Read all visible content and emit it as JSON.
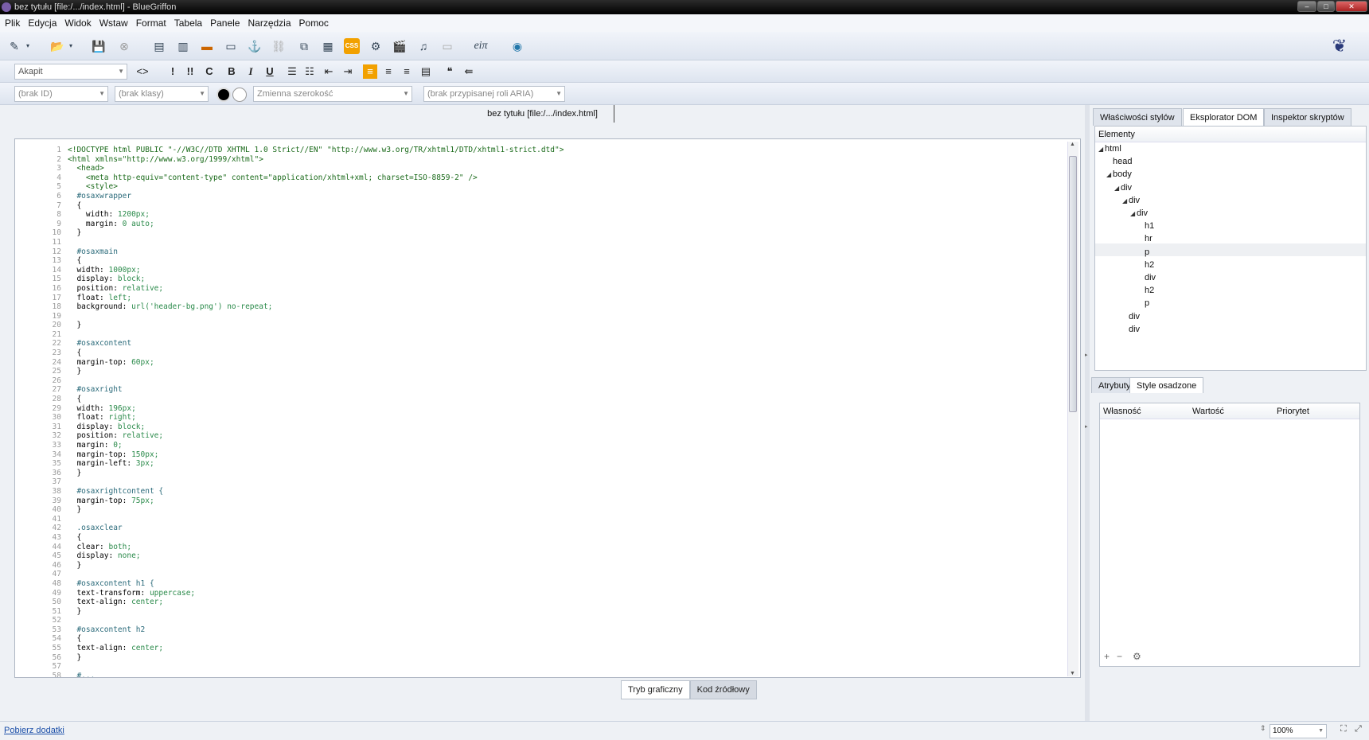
{
  "window": {
    "title": "bez tytułu [file:/.../index.html] - BlueGriffon",
    "buttons": {
      "minimize": "–",
      "maximize": "□",
      "close": "✕"
    }
  },
  "menu": [
    "Plik",
    "Edycja",
    "Widok",
    "Wstaw",
    "Format",
    "Tabela",
    "Panele",
    "Narzędzia",
    "Pomoc"
  ],
  "toolbar1": {
    "icons": [
      "new-document-icon",
      "open-icon",
      "save-icon",
      "close-document-icon",
      "layout-icon",
      "template-icon",
      "image-icon",
      "form-icon",
      "anchor-icon",
      "link-icon",
      "clip-icon",
      "table-icon",
      "css-icon",
      "settings-icon",
      "video-icon",
      "audio-icon",
      "box-icon",
      "math-icon",
      "globe-icon"
    ],
    "css_label": "CSS",
    "math_label": "eiπ"
  },
  "toolbar2": {
    "paragraph_format": "Akapit",
    "buttons": [
      "<>",
      "!",
      "!!",
      "C",
      "B",
      "I",
      "U"
    ]
  },
  "toolbar3": {
    "id_placeholder": "(brak ID)",
    "class_placeholder": "(brak klasy)",
    "width_mode": "Zmienna szerokość",
    "aria_role": "(brak przypisanej roli ARIA)"
  },
  "document_tab": "bez tytułu [file:/.../index.html]",
  "editor": {
    "lines": [
      "<!DOCTYPE html PUBLIC \"-//W3C//DTD XHTML 1.0 Strict//EN\" \"http://www.w3.org/TR/xhtml1/DTD/xhtml1-strict.dtd\">",
      "<html xmlns=\"http://www.w3.org/1999/xhtml\">",
      "  <head>",
      "    <meta http-equiv=\"content-type\" content=\"application/xhtml+xml; charset=ISO-8859-2\" />",
      "    <style>",
      "  #osaxwrapper",
      "  {",
      "    width: 1200px;",
      "    margin: 0 auto;",
      "  }",
      "",
      "  #osaxmain",
      "  {",
      "  width: 1000px;",
      "  display: block;",
      "  position: relative;",
      "  float: left;",
      "  background: url('header-bg.png') no-repeat;",
      "",
      "  }",
      "",
      "  #osaxcontent",
      "  {",
      "  margin-top: 60px;",
      "  }",
      "",
      "  #osaxright",
      "  {",
      "  width: 196px;",
      "  float: right;",
      "  display: block;",
      "  position: relative;",
      "  margin: 0;",
      "  margin-top: 150px;",
      "  margin-left: 3px;",
      "  }",
      "",
      "  #osaxrightcontent {",
      "  margin-top: 75px;",
      "  }",
      "",
      "  .osaxclear",
      "  {",
      "  clear: both;",
      "  display: none;",
      "  }",
      "",
      "  #osaxcontent h1 {",
      "  text-transform: uppercase;",
      "  text-align: center;",
      "  }",
      "",
      "  #osaxcontent h2",
      "  {",
      "  text-align: center;",
      "  }",
      "",
      "  #..."
    ]
  },
  "mode_buttons": {
    "graphic": "Tryb graficzny",
    "source": "Kod źródłowy"
  },
  "right_panel": {
    "tabs": [
      "Właściwości stylów",
      "Eksplorator DOM",
      "Inspektor skryptów"
    ],
    "dom_header": "Elementy",
    "dom_tree": [
      {
        "label": "html",
        "depth": 0,
        "expanded": true
      },
      {
        "label": "head",
        "depth": 1,
        "expanded": false
      },
      {
        "label": "body",
        "depth": 1,
        "expanded": true
      },
      {
        "label": "div",
        "depth": 2,
        "expanded": true
      },
      {
        "label": "div",
        "depth": 3,
        "expanded": true
      },
      {
        "label": "div",
        "depth": 4,
        "expanded": true
      },
      {
        "label": "h1",
        "depth": 5,
        "expanded": false
      },
      {
        "label": "hr",
        "depth": 5,
        "expanded": false
      },
      {
        "label": "p",
        "depth": 5,
        "expanded": false
      },
      {
        "label": "h2",
        "depth": 5,
        "expanded": false
      },
      {
        "label": "div",
        "depth": 5,
        "expanded": false
      },
      {
        "label": "h2",
        "depth": 5,
        "expanded": false
      },
      {
        "label": "p",
        "depth": 5,
        "expanded": false
      },
      {
        "label": "div",
        "depth": 3,
        "expanded": false
      },
      {
        "label": "div",
        "depth": 3,
        "expanded": false
      }
    ],
    "subtabs": [
      "Atrybuty",
      "Style osadzone"
    ],
    "props_columns": [
      "Własność",
      "Wartość",
      "Priorytet"
    ],
    "props_tools": [
      "+",
      "−",
      "⚙"
    ]
  },
  "status": {
    "addons_link": "Pobierz dodatki",
    "zoom": "100%"
  }
}
